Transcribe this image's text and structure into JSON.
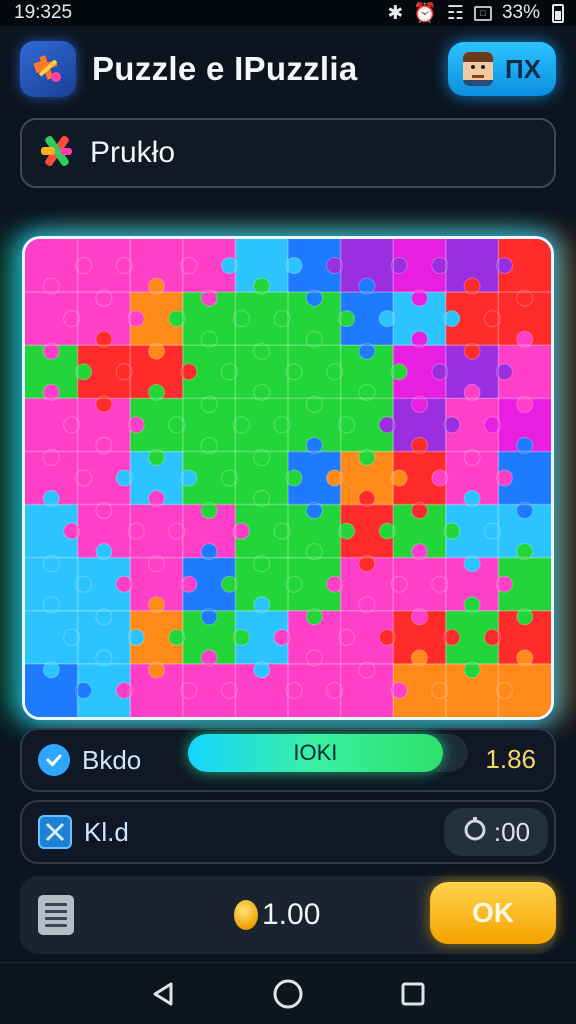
{
  "status_bar": {
    "time": "19:325",
    "battery": "33%"
  },
  "header": {
    "title": "Puzzle e IPuzzlia",
    "profile_label": "ПX"
  },
  "search": {
    "value": "Prukło"
  },
  "board": {
    "palette": [
      "#ff3fc8",
      "#ff2a2a",
      "#ff8a1a",
      "#22d63a",
      "#1e7bff",
      "#2cc4ff",
      "#9b2fe0",
      "#e81ee0"
    ]
  },
  "progress_row": {
    "label": "Bkdo",
    "bar_text": "IOKI",
    "value": "1.86",
    "fill_fraction": 0.91
  },
  "timer_row": {
    "label": "Kl.d",
    "timer": ":00"
  },
  "bottom_bar": {
    "coins": "1.00",
    "ok_label": "OK"
  },
  "icons": {
    "app_logo": "puzzle-cross-icon",
    "search_prefix": "colorful-cross-icon",
    "check": "check-icon",
    "puzzle_badge": "puzzle-piece-icon",
    "timer": "stopwatch-icon",
    "document": "document-icon",
    "coin": "coin-icon",
    "nav_back": "triangle-back-icon",
    "nav_home": "circle-home-icon",
    "nav_recent": "square-recent-icon"
  }
}
